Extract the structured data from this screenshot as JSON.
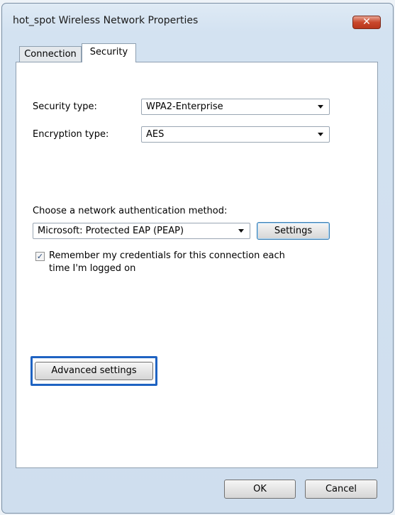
{
  "window": {
    "title": "hot_spot Wireless Network Properties",
    "close_glyph": "✕"
  },
  "tabs": [
    {
      "label": "Connection"
    },
    {
      "label": "Security"
    }
  ],
  "security": {
    "security_type_label": "Security type:",
    "security_type_value": "WPA2-Enterprise",
    "encryption_type_label": "Encryption type:",
    "encryption_type_value": "AES",
    "auth_method_label": "Choose a network authentication method:",
    "auth_method_value": "Microsoft: Protected EAP (PEAP)",
    "settings_label": "Settings",
    "remember_line1": "Remember my credentials for this connection each",
    "remember_line2": "time I'm logged on",
    "remember_checked_glyph": "✓",
    "advanced_label": "Advanced settings"
  },
  "footer": {
    "ok_label": "OK",
    "cancel_label": "Cancel"
  },
  "colors": {
    "highlight": "#1f63c2",
    "close": "#c9472c"
  }
}
